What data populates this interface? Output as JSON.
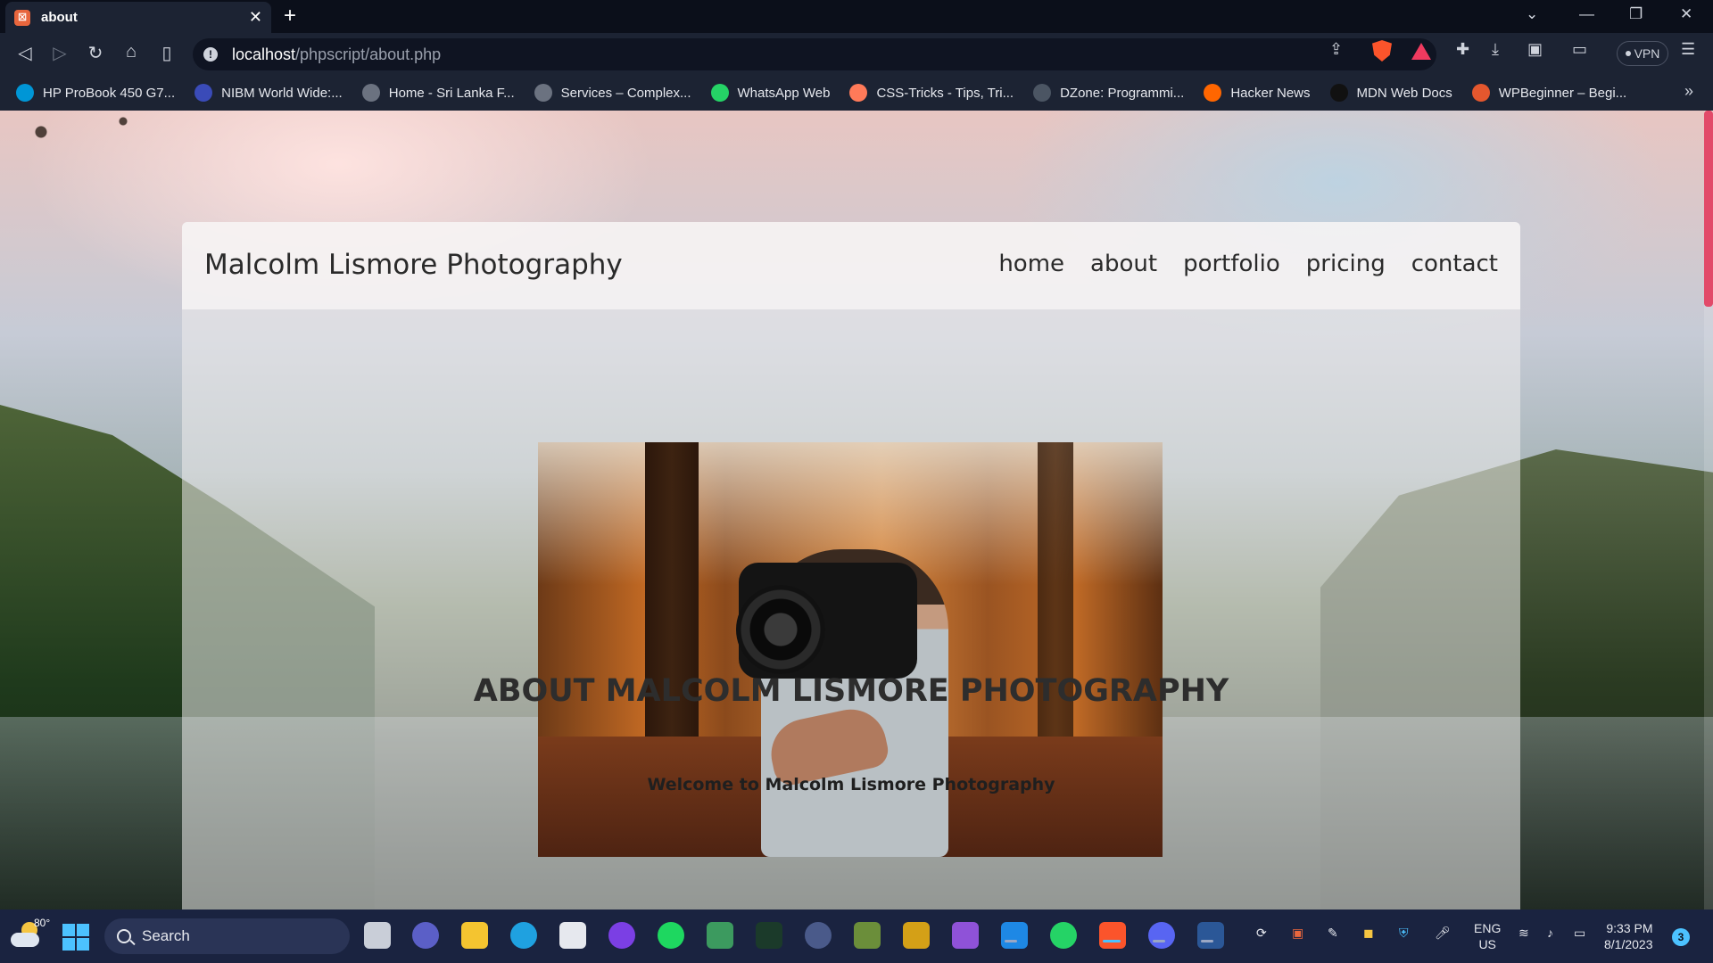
{
  "browser": {
    "tab_title": "about",
    "new_tab": "+",
    "address": {
      "host": "localhost",
      "path": "/phpscript/about.php"
    },
    "vpn_label": "VPN",
    "bookmarks": [
      {
        "label": "HP ProBook 450 G7...",
        "icon": "hp-icon",
        "color": "#0096d6"
      },
      {
        "label": "NIBM World Wide:...",
        "icon": "nibm-icon",
        "color": "#3a4bb8"
      },
      {
        "label": "Home - Sri Lanka F...",
        "icon": "globe-icon",
        "color": "#6b7280"
      },
      {
        "label": "Services – Complex...",
        "icon": "globe-icon",
        "color": "#6b7280"
      },
      {
        "label": "WhatsApp Web",
        "icon": "whatsapp-icon",
        "color": "#25d366"
      },
      {
        "label": "CSS-Tricks - Tips, Tri...",
        "icon": "css-tricks-icon",
        "color": "#ff7a59"
      },
      {
        "label": "DZone: Programmi...",
        "icon": "dzone-icon",
        "color": "#4b5563"
      },
      {
        "label": "Hacker News",
        "icon": "hacker-news-icon",
        "color": "#ff6600"
      },
      {
        "label": "MDN Web Docs",
        "icon": "mdn-icon",
        "color": "#111111"
      },
      {
        "label": "WPBeginner – Begi...",
        "icon": "wpbeginner-icon",
        "color": "#e4572e"
      }
    ]
  },
  "site": {
    "brand": "Malcolm Lismore Photography",
    "nav": [
      "home",
      "about",
      "portfolio",
      "pricing",
      "contact"
    ],
    "about_title": "ABOUT MALCOLM LISMORE PHOTOGRAPHY",
    "welcome": "Welcome to Malcolm Lismore Photography"
  },
  "taskbar": {
    "weather_temp": "80°",
    "search_placeholder": "Search",
    "lang_line1": "ENG",
    "lang_line2": "US",
    "time": "9:33 PM",
    "date": "8/1/2023",
    "notification_count": "3"
  }
}
